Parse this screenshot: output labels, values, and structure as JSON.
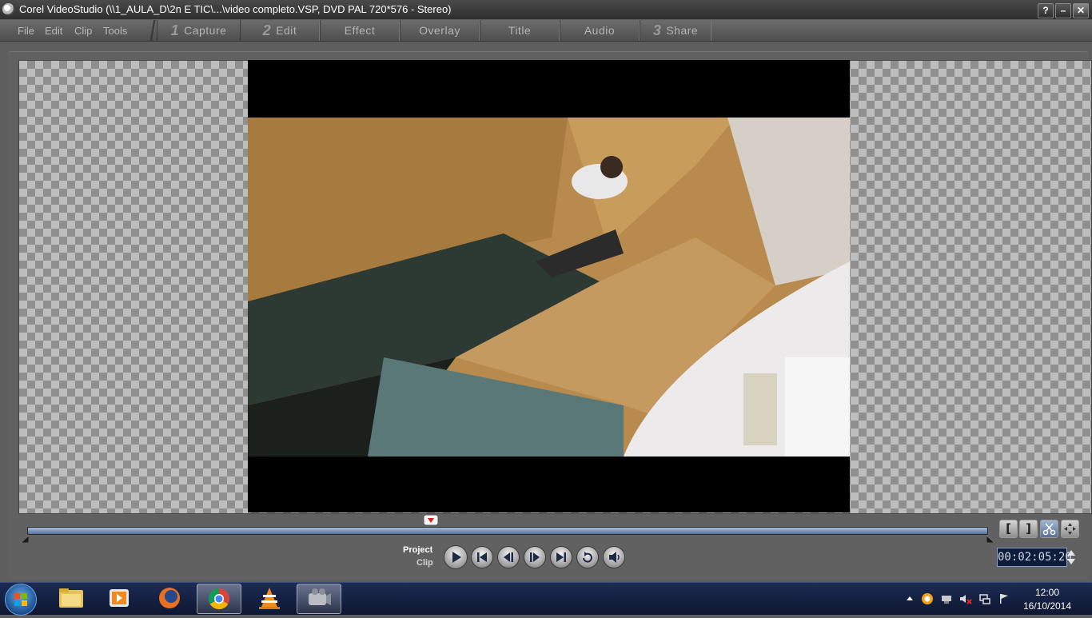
{
  "window": {
    "title": "Corel VideoStudio (\\\\1_AULA_D\\2n E TIC\\...\\video completo.VSP, DVD PAL 720*576 - Stereo)",
    "help_label": "?",
    "minimize_label": "–",
    "close_label": "✕"
  },
  "menu": {
    "items": [
      "File",
      "Edit",
      "Clip",
      "Tools"
    ]
  },
  "steps": [
    {
      "number": "1",
      "label": "Capture"
    },
    {
      "number": "2",
      "label": "Edit"
    },
    {
      "number": "",
      "label": "Effect"
    },
    {
      "number": "",
      "label": "Overlay"
    },
    {
      "number": "",
      "label": "Title"
    },
    {
      "number": "",
      "label": "Audio"
    },
    {
      "number": "3",
      "label": "Share"
    }
  ],
  "playback": {
    "mode_project": "Project",
    "mode_clip": "Clip",
    "scrubber_position": 0.42,
    "timecode": "00:02:05:20"
  },
  "trim_buttons": [
    "[",
    "]"
  ],
  "taskbar": {
    "apps": [
      "windows-explorer",
      "media-player",
      "firefox",
      "chrome",
      "vlc",
      "corel-videostudio"
    ],
    "clock_time": "12:00",
    "clock_date": "16/10/2014"
  },
  "colors": {
    "timeline_accent": "#6f8bb8",
    "timecode_bg": "#0f1d3d"
  }
}
